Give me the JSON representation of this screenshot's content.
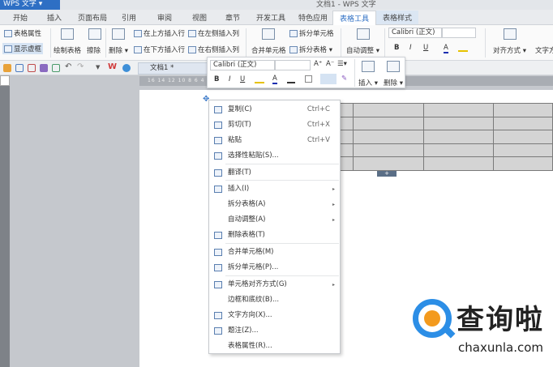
{
  "titlebar": {
    "app_button": "WPS 文字 ▾",
    "title": "文档1 - WPS 文字"
  },
  "tabs": [
    "开始",
    "插入",
    "页面布局",
    "引用",
    "审阅",
    "视图",
    "章节",
    "开发工具",
    "特色应用",
    "表格工具",
    "表格样式"
  ],
  "active_tab": "表格工具",
  "ribbon": {
    "table_props": "表格属性",
    "show_gridlines": "显示虚框",
    "draw_table": "绘制表格",
    "erase": "擦除",
    "delete": "删除 ▾",
    "insert_above": "在上方插入行",
    "insert_below": "在下方插入行",
    "insert_left": "在左侧插入列",
    "insert_right": "在右侧插入列",
    "merge_cells": "合并单元格",
    "split_cells": "拆分单元格",
    "split_table": "拆分表格 ▾",
    "auto_fit": "自动调整 ▾",
    "font": "Calibri (正文)",
    "bold": "B",
    "italic": "I",
    "underline": "U",
    "font_color": "A",
    "align": "对齐方式 ▾",
    "text_dir": "文字方"
  },
  "qat": {
    "doc_tab": "文档1 *"
  },
  "ruler": "16  14  12  10  8  6  4  2     2  4  6  8  10  12  14  16  18  20  22  24  26  28  30  32  34  36  38",
  "mini": {
    "font": "Calibri (正文)",
    "grow": "A⁺",
    "shrink": "A⁻",
    "bold": "B",
    "italic": "I",
    "underline": "U",
    "insert": "插入 ▾",
    "delete": "删除 ▾"
  },
  "menu": [
    {
      "label": "复制(C)",
      "shortcut": "Ctrl+C",
      "icon": "copy-icon"
    },
    {
      "label": "剪切(T)",
      "shortcut": "Ctrl+X",
      "icon": "cut-icon"
    },
    {
      "label": "粘贴",
      "shortcut": "Ctrl+V",
      "icon": "paste-icon"
    },
    {
      "label": "选择性粘贴(S)...",
      "icon": "paste-special-icon"
    },
    {
      "label": "翻译(T)",
      "icon": "translate-icon"
    },
    {
      "label": "插入(I)",
      "submenu": true,
      "icon": "insert-table-icon"
    },
    {
      "label": "拆分表格(A)",
      "submenu": true
    },
    {
      "label": "自动调整(A)",
      "submenu": true
    },
    {
      "label": "删除表格(T)",
      "icon": "delete-table-icon"
    },
    {
      "label": "合并单元格(M)",
      "icon": "merge-cells-icon"
    },
    {
      "label": "拆分单元格(P)...",
      "icon": "split-cells-icon"
    },
    {
      "label": "单元格对齐方式(G)",
      "submenu": true,
      "icon": "cell-align-icon"
    },
    {
      "label": "边框和底纹(B)..."
    },
    {
      "label": "文字方向(X)...",
      "icon": "text-direction-icon"
    },
    {
      "label": "题注(Z)...",
      "icon": "caption-icon"
    },
    {
      "label": "表格属性(R)..."
    }
  ],
  "watermark": {
    "name": "查询啦",
    "url": "chaxunla.com"
  }
}
